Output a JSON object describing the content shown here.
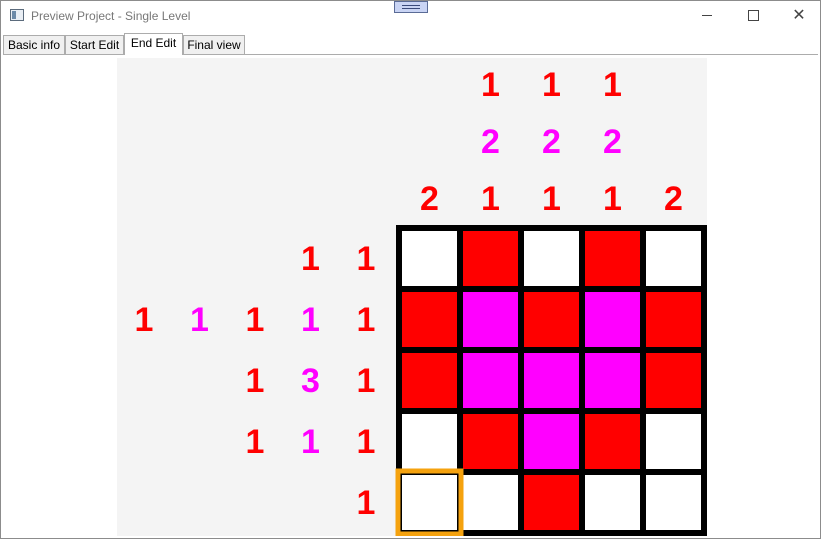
{
  "window": {
    "title": "Preview Project - Single Level"
  },
  "titlebar_buttons": {
    "minimize": "minimize",
    "maximize": "maximize",
    "close": "close"
  },
  "tabs": [
    {
      "label": "Basic info",
      "active": false
    },
    {
      "label": "Start Edit",
      "active": false
    },
    {
      "label": "End Edit",
      "active": true
    },
    {
      "label": "Final view",
      "active": false
    }
  ],
  "colors": {
    "red": "#ff0000",
    "magenta": "#ff00ff",
    "white": "#ffffff",
    "grid_line": "#000000",
    "selection": "#f5a20e",
    "board_bg": "#f4f4f4"
  },
  "puzzle": {
    "rows": 5,
    "cols": 5,
    "column_clues": [
      [
        {
          "value": "2",
          "color": "red"
        }
      ],
      [
        {
          "value": "1",
          "color": "red"
        },
        {
          "value": "2",
          "color": "magenta"
        },
        {
          "value": "1",
          "color": "red"
        }
      ],
      [
        {
          "value": "1",
          "color": "red"
        },
        {
          "value": "2",
          "color": "magenta"
        },
        {
          "value": "1",
          "color": "red"
        }
      ],
      [
        {
          "value": "1",
          "color": "red"
        },
        {
          "value": "2",
          "color": "magenta"
        },
        {
          "value": "1",
          "color": "red"
        }
      ],
      [
        {
          "value": "2",
          "color": "red"
        }
      ]
    ],
    "row_clues": [
      [
        {
          "value": "1",
          "color": "red"
        },
        {
          "value": "1",
          "color": "red"
        }
      ],
      [
        {
          "value": "1",
          "color": "red"
        },
        {
          "value": "1",
          "color": "magenta"
        },
        {
          "value": "1",
          "color": "red"
        },
        {
          "value": "1",
          "color": "magenta"
        },
        {
          "value": "1",
          "color": "red"
        }
      ],
      [
        {
          "value": "1",
          "color": "red"
        },
        {
          "value": "3",
          "color": "magenta"
        },
        {
          "value": "1",
          "color": "red"
        }
      ],
      [
        {
          "value": "1",
          "color": "red"
        },
        {
          "value": "1",
          "color": "magenta"
        },
        {
          "value": "1",
          "color": "red"
        }
      ],
      [
        {
          "value": "1",
          "color": "red"
        }
      ]
    ],
    "cells": [
      [
        "white",
        "red",
        "white",
        "red",
        "white"
      ],
      [
        "red",
        "magenta",
        "red",
        "magenta",
        "red"
      ],
      [
        "red",
        "magenta",
        "magenta",
        "magenta",
        "red"
      ],
      [
        "white",
        "red",
        "magenta",
        "red",
        "white"
      ],
      [
        "white",
        "white",
        "red",
        "white",
        "white"
      ]
    ],
    "selected_cell": {
      "row": 4,
      "col": 0
    }
  }
}
